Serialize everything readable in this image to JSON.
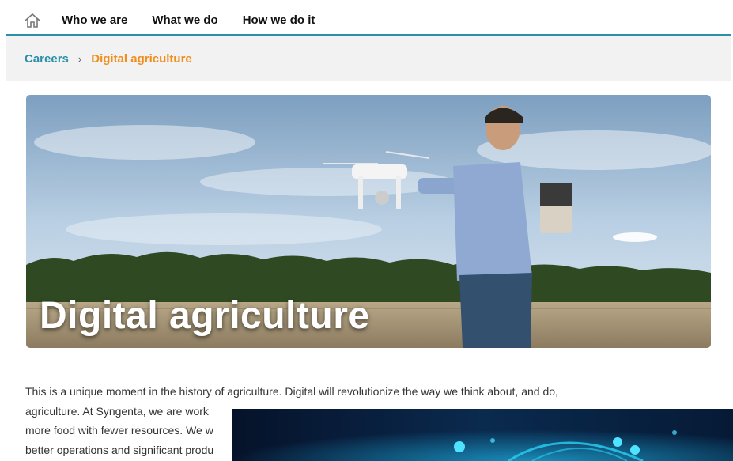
{
  "nav": {
    "items": [
      "Who we are",
      "What we do",
      "How we do it"
    ]
  },
  "breadcrumb": {
    "parent": "Careers",
    "separator": "›",
    "current": "Digital agriculture"
  },
  "hero": {
    "title": "Digital agriculture"
  },
  "intro": {
    "lines": [
      "This is a unique moment in the history of agriculture. Digital will revolutionize the way we think about, and do,",
      "agriculture. At Syngenta, we are work",
      "more food with fewer resources. We w",
      "better operations and significant produ"
    ]
  },
  "colors": {
    "nav_border": "#2b8fa8",
    "breadcrumb_link": "#2b8fa8",
    "breadcrumb_current": "#f28c1b"
  }
}
